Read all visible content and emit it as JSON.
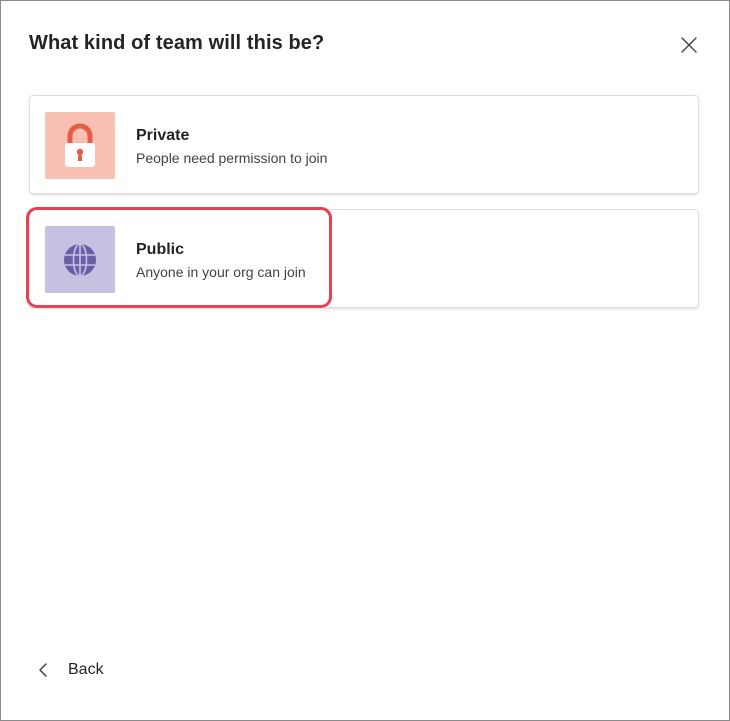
{
  "dialog": {
    "title": "What kind of team will this be?",
    "close_icon": "close-icon",
    "options": [
      {
        "title": "Private",
        "description": "People need permission to join",
        "icon": "lock-icon",
        "icon_bg": "#f8c0b3",
        "icon_color": "#e35d45"
      },
      {
        "title": "Public",
        "description": "Anyone in your org can join",
        "icon": "globe-icon",
        "icon_bg": "#c5c1e0",
        "icon_color": "#6b5fa8",
        "highlighted": true
      }
    ],
    "highlight_color": "#e8414f",
    "back_label": "Back",
    "back_icon": "chevron-left-icon"
  }
}
